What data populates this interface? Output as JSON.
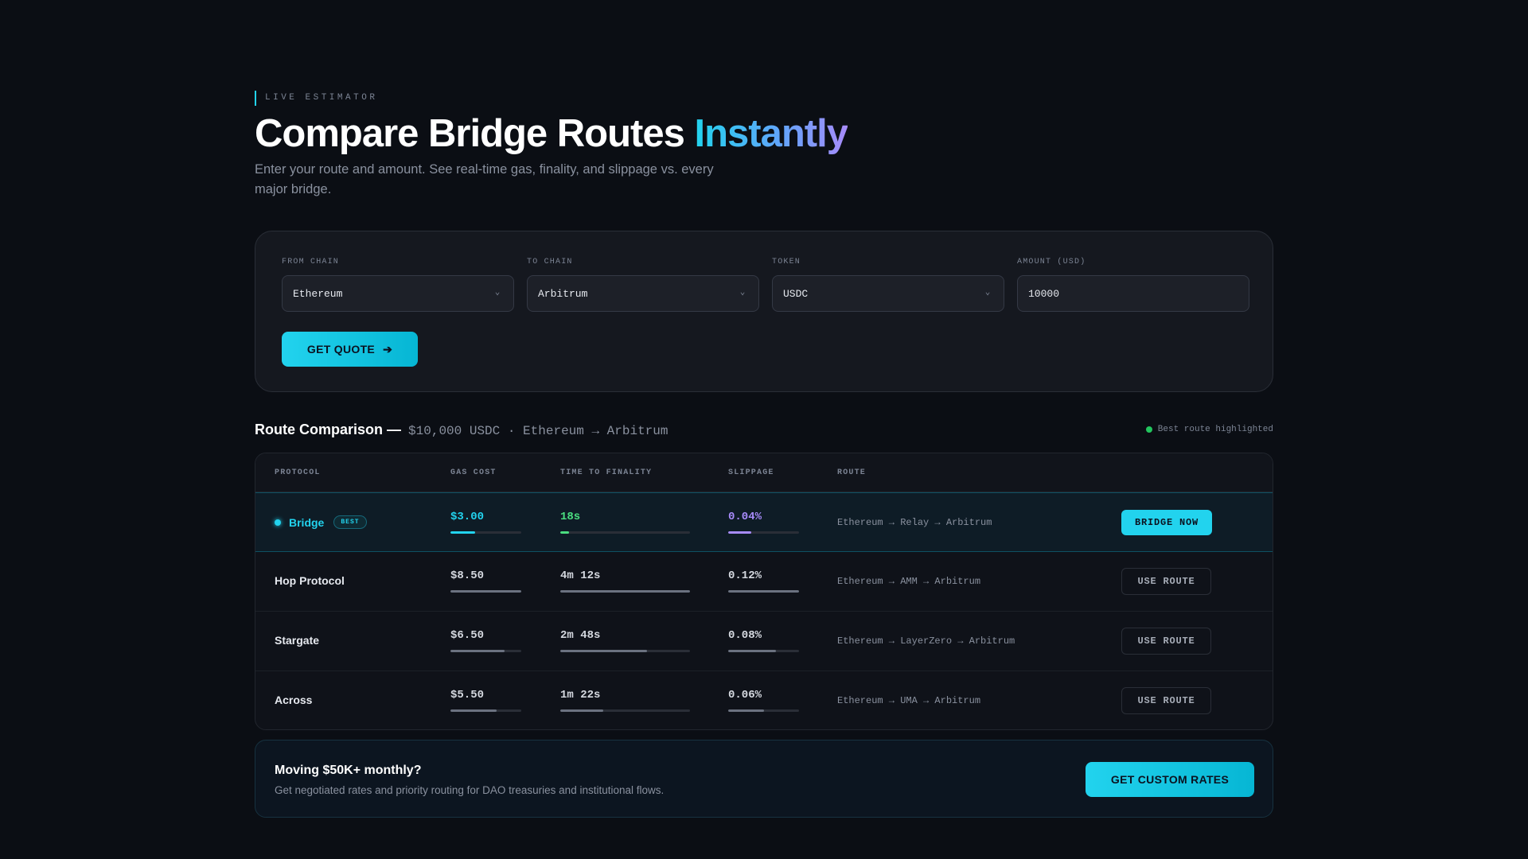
{
  "hero": {
    "eyebrow": "LIVE ESTIMATOR",
    "title_main": "Compare Bridge Routes",
    "title_accent": "Instantly",
    "subtitle": "Enter your route and amount. See real-time gas, finality, and slippage vs. every major bridge."
  },
  "form": {
    "from_label": "FROM CHAIN",
    "from_value": "Ethereum",
    "to_label": "TO CHAIN",
    "to_value": "Arbitrum",
    "token_label": "TOKEN",
    "token_value": "USDC",
    "amount_label": "AMOUNT (USD)",
    "amount_value": "10000",
    "quote_button": "GET QUOTE"
  },
  "comparison": {
    "title": "Route Comparison —",
    "meta": "$10,000 USDC · Ethereum → Arbitrum",
    "legend": "Best route highlighted"
  },
  "table": {
    "headers": [
      "PROTOCOL",
      "GAS COST",
      "TIME TO FINALITY",
      "SLIPPAGE",
      "ROUTE"
    ],
    "rows": [
      {
        "protocol": "Bridge",
        "badge": "BEST",
        "gas": "$3.00",
        "gas_level": 0.35,
        "time": "18s",
        "time_level": 0.07,
        "slippage": "0.04%",
        "slippage_level": 0.33,
        "route": "Ethereum → Relay → Arbitrum",
        "action": "BRIDGE NOW"
      },
      {
        "protocol": "Hop Protocol",
        "gas": "$8.50",
        "gas_level": 1.0,
        "time": "4m 12s",
        "time_level": 1.0,
        "slippage": "0.12%",
        "slippage_level": 1.0,
        "route": "Ethereum → AMM → Arbitrum",
        "action": "USE ROUTE"
      },
      {
        "protocol": "Stargate",
        "gas": "$6.50",
        "gas_level": 0.76,
        "time": "2m 48s",
        "time_level": 0.67,
        "slippage": "0.08%",
        "slippage_level": 0.67,
        "route": "Ethereum → LayerZero → Arbitrum",
        "action": "USE ROUTE"
      },
      {
        "protocol": "Across",
        "gas": "$5.50",
        "gas_level": 0.65,
        "time": "1m 22s",
        "time_level": 0.33,
        "slippage": "0.06%",
        "slippage_level": 0.5,
        "route": "Ethereum → UMA → Arbitrum",
        "action": "USE ROUTE"
      }
    ]
  },
  "cta": {
    "title": "Moving $50K+ monthly?",
    "subtitle": "Get negotiated rates and priority routing for DAO treasuries and institutional flows.",
    "button": "GET CUSTOM RATES"
  },
  "colors": {
    "accent": "#22d3ee",
    "best_time": "#4ade80",
    "best_slippage": "#a78bfa",
    "legend_dot": "#22c55e"
  },
  "icons": {
    "select_chevron": "chevron-down-icon",
    "quote_arrow": "arrow-right-icon",
    "legend": "status-dot-icon"
  }
}
